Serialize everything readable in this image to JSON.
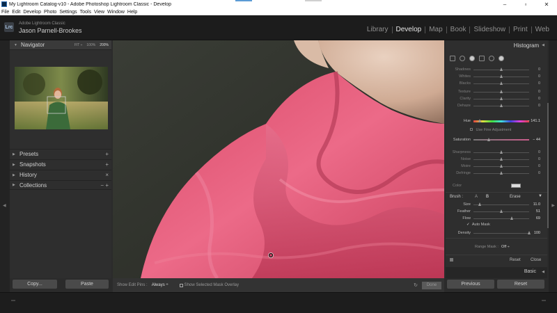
{
  "window": {
    "title": "My Lightroom Catalog-v10 - Adobe Photoshop Lightroom Classic - Develop",
    "controls": [
      "–",
      "▫",
      "✕"
    ]
  },
  "menubar": [
    "File",
    "Edit",
    "Develop",
    "Photo",
    "Settings",
    "Tools",
    "View",
    "Window",
    "Help"
  ],
  "identity": {
    "logo": "Lrc",
    "product": "Adobe Lightroom Classic",
    "user": "Jason Parnell-Brookes"
  },
  "modules": [
    {
      "label": "Library",
      "active": false
    },
    {
      "label": "Develop",
      "active": true
    },
    {
      "label": "Map",
      "active": false
    },
    {
      "label": "Book",
      "active": false
    },
    {
      "label": "Slideshow",
      "active": false
    },
    {
      "label": "Print",
      "active": false
    },
    {
      "label": "Web",
      "active": false
    }
  ],
  "left": {
    "navigator": {
      "title": "Navigator",
      "zoom_options": [
        "FIT ÷",
        "100%",
        "200%"
      ],
      "zoom_active": "200%"
    },
    "panels": [
      {
        "label": "Presets",
        "action": "+"
      },
      {
        "label": "Snapshots",
        "action": "+"
      },
      {
        "label": "History",
        "action": "×"
      },
      {
        "label": "Collections",
        "action": "− +"
      }
    ],
    "buttons": {
      "copy": "Copy...",
      "paste": "Paste"
    }
  },
  "toolbar": {
    "pins_label": "Show Edit Pins :",
    "pins_value": "Always ÷",
    "overlay_label": "Show Selected Mask Overlay",
    "overlay_checked": true,
    "done": "Done"
  },
  "right": {
    "histogram": "Histogram",
    "tools": [
      "crop-tool-icon",
      "spot-removal-icon",
      "red-eye-icon",
      "graduated-filter-icon",
      "radial-filter-icon",
      "adjustment-brush-icon"
    ],
    "sliders_top": [
      {
        "label": "Shadows",
        "value": "0",
        "pos": 0.5
      },
      {
        "label": "Whites",
        "value": "0",
        "pos": 0.5
      },
      {
        "label": "Blacks",
        "value": "0",
        "pos": 0.5
      }
    ],
    "sliders_presence": [
      {
        "label": "Texture",
        "value": "0",
        "pos": 0.5
      },
      {
        "label": "Clarity",
        "value": "0",
        "pos": 0.5
      },
      {
        "label": "Dehaze",
        "value": "0",
        "pos": 0.5
      }
    ],
    "hue": {
      "label": "Hue",
      "value": "− 141.1",
      "pos": 0.12
    },
    "fine_adjustment": "Use Fine Adjustment",
    "saturation": {
      "label": "Saturation",
      "value": "− 44",
      "pos": 0.28
    },
    "sliders_detail": [
      {
        "label": "Sharpness",
        "value": "0",
        "pos": 0.5
      },
      {
        "label": "Noise",
        "value": "0",
        "pos": 0.5
      },
      {
        "label": "Moire",
        "value": "0",
        "pos": 0.5
      },
      {
        "label": "Defringe",
        "value": "0",
        "pos": 0.5
      }
    ],
    "color_label": "Color",
    "brush": {
      "label": "Brush :",
      "a": "A",
      "b": "B",
      "erase": "Erase",
      "size": {
        "label": "Size",
        "value": "11.0",
        "pos": 0.12
      },
      "feather": {
        "label": "Feather",
        "value": "51",
        "pos": 0.51
      },
      "flow": {
        "label": "Flow",
        "value": "69",
        "pos": 0.69
      },
      "auto_mask": "Auto Mask",
      "density": {
        "label": "Density",
        "value": "100",
        "pos": 1.0
      }
    },
    "range_mask": {
      "label": "Range Mask :",
      "value": "Off ÷"
    },
    "reset": "Reset",
    "close": "Close",
    "basic": "Basic",
    "buttons": {
      "previous": "Previous",
      "reset": "Reset"
    }
  }
}
